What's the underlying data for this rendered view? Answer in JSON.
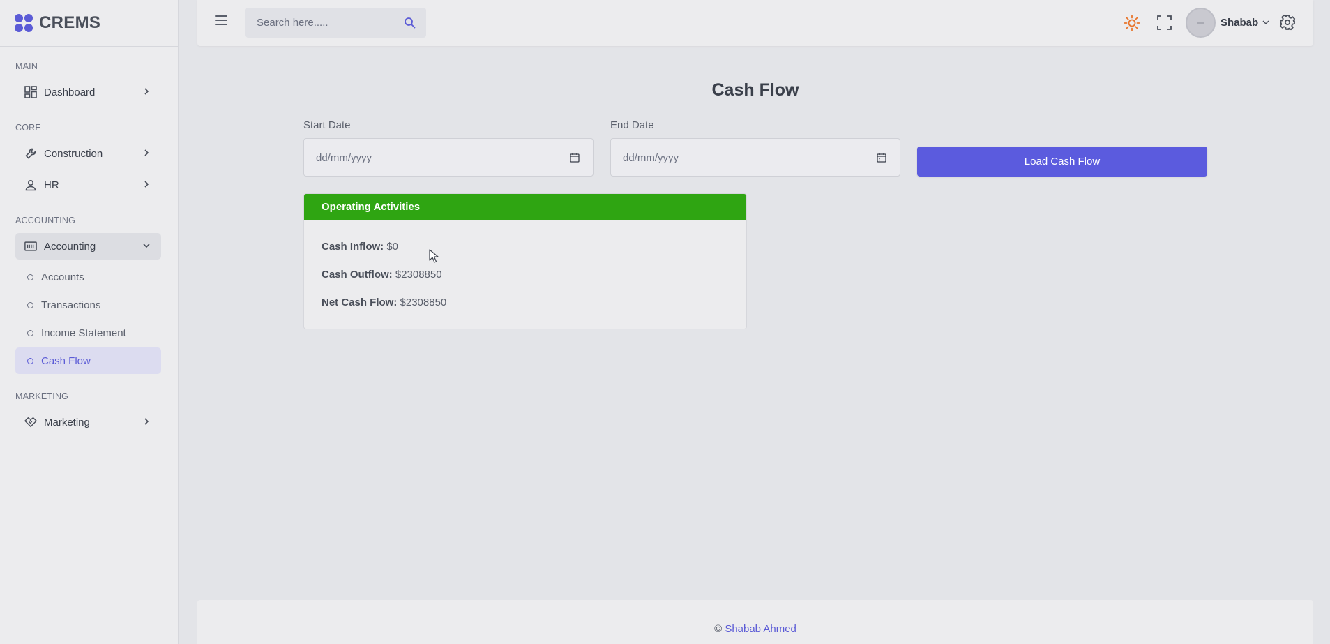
{
  "app": {
    "brand": "CREMS"
  },
  "sidebar": {
    "sections": {
      "main": "MAIN",
      "core": "CORE",
      "accounting": "ACCOUNTING",
      "marketing": "MARKETING"
    },
    "items": {
      "dashboard": "Dashboard",
      "construction": "Construction",
      "hr": "HR",
      "accounting": "Accounting",
      "marketing": "Marketing"
    },
    "accounting_sub": {
      "accounts": "Accounts",
      "transactions": "Transactions",
      "income_statement": "Income Statement",
      "cash_flow": "Cash Flow"
    }
  },
  "header": {
    "search_placeholder": "Search here.....",
    "user_name": "Shabab"
  },
  "main": {
    "title": "Cash Flow",
    "start_date_label": "Start Date",
    "end_date_label": "End Date",
    "date_placeholder": "dd/mm/yyyy",
    "load_button": "Load Cash Flow",
    "card": {
      "title": "Operating Activities",
      "inflow_label": "Cash Inflow:",
      "inflow_value": "$0",
      "outflow_label": "Cash Outflow:",
      "outflow_value": "$2308850",
      "net_label": "Net Cash Flow:",
      "net_value": "$2308850"
    }
  },
  "footer": {
    "copyright": "©",
    "author": "Shabab Ahmed"
  },
  "colors": {
    "accent": "#5b5bde",
    "card_header": "#2fa512",
    "sun_icon": "#e8742a"
  }
}
